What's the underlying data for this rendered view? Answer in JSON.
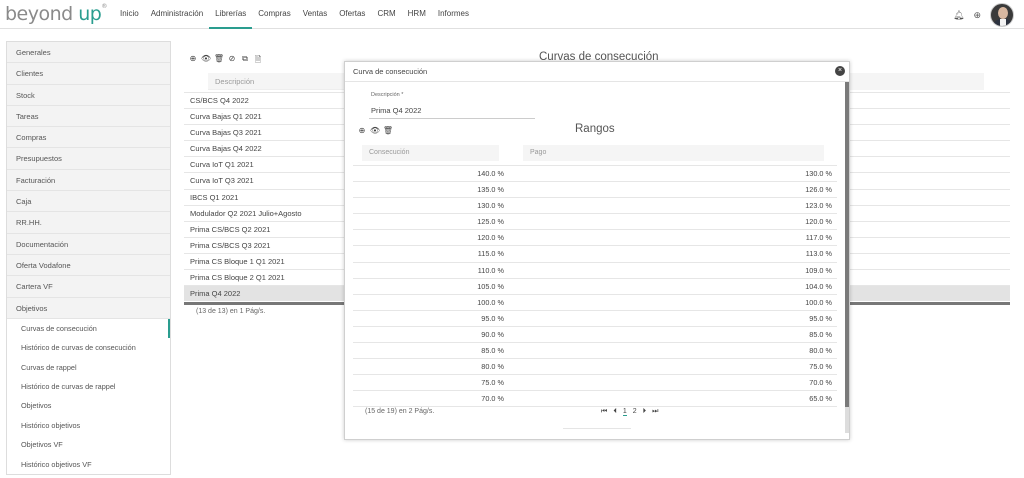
{
  "header": {
    "logo_main": "beyond ",
    "logo_accent": "up",
    "logo_mark": "®",
    "nav": [
      "Inicio",
      "Administración",
      "Librerías",
      "Compras",
      "Ventas",
      "Ofertas",
      "CRM",
      "HRM",
      "Informes"
    ],
    "active_nav": "Librerías",
    "icons": [
      "bell-icon",
      "add-circle-icon",
      "avatar"
    ]
  },
  "sidebar": {
    "items": [
      "Generales",
      "Clientes",
      "Stock",
      "Tareas",
      "Compras",
      "Presupuestos",
      "Facturación",
      "Caja",
      "RR.HH.",
      "Documentación",
      "Oferta Vodafone",
      "Cartera VF",
      "Objetivos"
    ],
    "subitems": [
      "Curvas de consecución",
      "Histórico de curvas de consecución",
      "Curvas de rappel",
      "Histórico de curvas de rappel",
      "Objetivos",
      "Histórico objetivos",
      "Objetivos VF",
      "Histórico objetivos VF"
    ],
    "active_subitem": "Curvas de consecución"
  },
  "main": {
    "title": "Curvas de consecución",
    "toolbar": {
      "add": "⊕",
      "view": "👁",
      "delete": "🗑",
      "cancel": "⊘",
      "copy": "⧉",
      "export": "🗎"
    },
    "filter_placeholder": "Descripción",
    "rows": [
      "CS/BCS Q4 2022",
      "Curva Bajas Q1 2021",
      "Curva Bajas Q3 2021",
      "Curva Bajas Q4 2022",
      "Curva IoT Q1 2021",
      "Curva IoT Q3 2021",
      "IBCS Q1 2021",
      "Modulador Q2 2021 Julio+Agosto",
      "Prima CS/BCS Q2 2021",
      "Prima CS/BCS Q3 2021",
      "Prima CS Bloque 1 Q1 2021",
      "Prima CS Bloque 2 Q1 2021",
      "Prima Q4 2022"
    ],
    "selected_row": "Prima Q4 2022",
    "footer": "(13 de 13) en 1 Pág/s."
  },
  "modal": {
    "title": "Curva de consecución",
    "close": "×",
    "desc_label": "Descripción *",
    "desc_value": "Prima Q4 2022",
    "toolbar": {
      "add": "⊕",
      "view": "👁",
      "delete": "🗑"
    },
    "section": "Rangos",
    "col1_placeholder": "Consecución",
    "col2_placeholder": "Pago",
    "rows": [
      [
        "140.0 %",
        "130.0 %"
      ],
      [
        "135.0 %",
        "126.0 %"
      ],
      [
        "130.0 %",
        "123.0 %"
      ],
      [
        "125.0 %",
        "120.0 %"
      ],
      [
        "120.0 %",
        "117.0 %"
      ],
      [
        "115.0 %",
        "113.0 %"
      ],
      [
        "110.0 %",
        "109.0 %"
      ],
      [
        "105.0 %",
        "104.0 %"
      ],
      [
        "100.0 %",
        "100.0 %"
      ],
      [
        "95.0 %",
        "95.0 %"
      ],
      [
        "90.0 %",
        "85.0 %"
      ],
      [
        "85.0 %",
        "80.0 %"
      ],
      [
        "80.0 %",
        "75.0 %"
      ],
      [
        "75.0 %",
        "70.0 %"
      ],
      [
        "70.0 %",
        "65.0 %"
      ]
    ],
    "footer": "(15 de 19) en 2 Pág/s.",
    "pager": {
      "first": "⏮",
      "prev": "⏴",
      "page1": "1",
      "page2": "2",
      "next": "⏵",
      "last": "⏭"
    }
  },
  "colors": {
    "accent": "#2a9d8f"
  }
}
